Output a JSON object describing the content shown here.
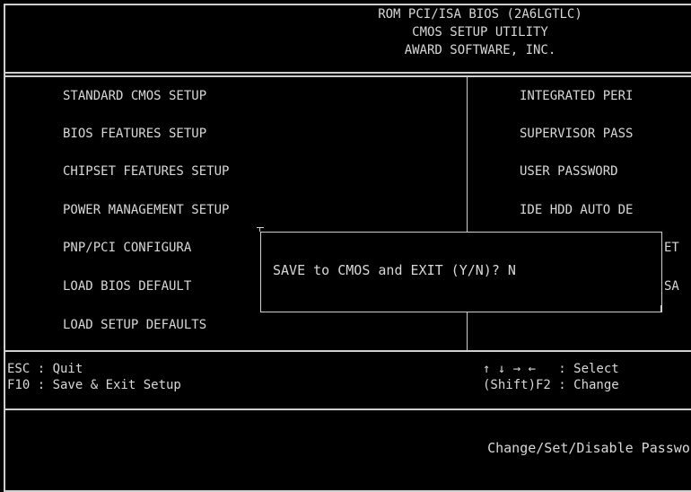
{
  "header": {
    "line1": "ROM PCI/ISA BIOS (2A6LGTLC)",
    "line2": "CMOS SETUP UTILITY",
    "line3": "AWARD SOFTWARE, INC."
  },
  "menu": {
    "left": [
      "STANDARD CMOS SETUP",
      "BIOS FEATURES SETUP",
      "CHIPSET FEATURES SETUP",
      "POWER MANAGEMENT SETUP",
      "PNP/PCI CONFIGURA",
      "LOAD BIOS DEFAULT",
      "LOAD SETUP DEFAULTS"
    ],
    "right": [
      "INTEGRATED PERI",
      "SUPERVISOR PASS",
      "USER PASSWORD",
      "IDE HDD AUTO DE",
      "ET",
      "SA"
    ]
  },
  "dialog": {
    "prompt": "SAVE to CMOS and EXIT (Y/N)? N"
  },
  "help": {
    "left_line1": "ESC : Quit",
    "left_line2": "F10 : Save & Exit Setup",
    "right_line1": "↑ ↓ → ←   : Select",
    "right_line2": "(Shift)F2 : Change"
  },
  "footer": {
    "description": "Change/Set/Disable Password"
  }
}
